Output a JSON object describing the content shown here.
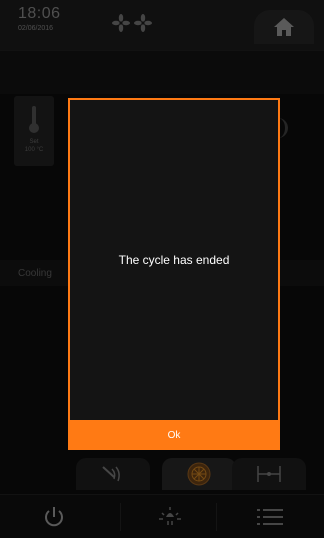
{
  "status": {
    "time": "18:06",
    "date": "02/06/2016",
    "fan_icons": [
      "fan-icon",
      "fan-icon"
    ],
    "home_icon": "home-icon"
  },
  "panel": {
    "temp_icon": "thermometer-icon",
    "temp_label": "Set",
    "temp_value": "100 °C",
    "phase_label": "Cooling"
  },
  "modal": {
    "message": "The cycle has ended",
    "ok_label": "Ok"
  },
  "modes": [
    {
      "icon": "steam-icon",
      "active": false
    },
    {
      "icon": "fan-mode-icon",
      "active": true
    },
    {
      "icon": "probe-icon",
      "active": false
    }
  ],
  "bottom": [
    {
      "icon": "power-icon"
    },
    {
      "icon": "light-icon"
    },
    {
      "icon": "menu-icon"
    }
  ],
  "colors": {
    "accent": "#ff7a14",
    "background": "#0b0b0b",
    "modal_bg": "#141414"
  }
}
